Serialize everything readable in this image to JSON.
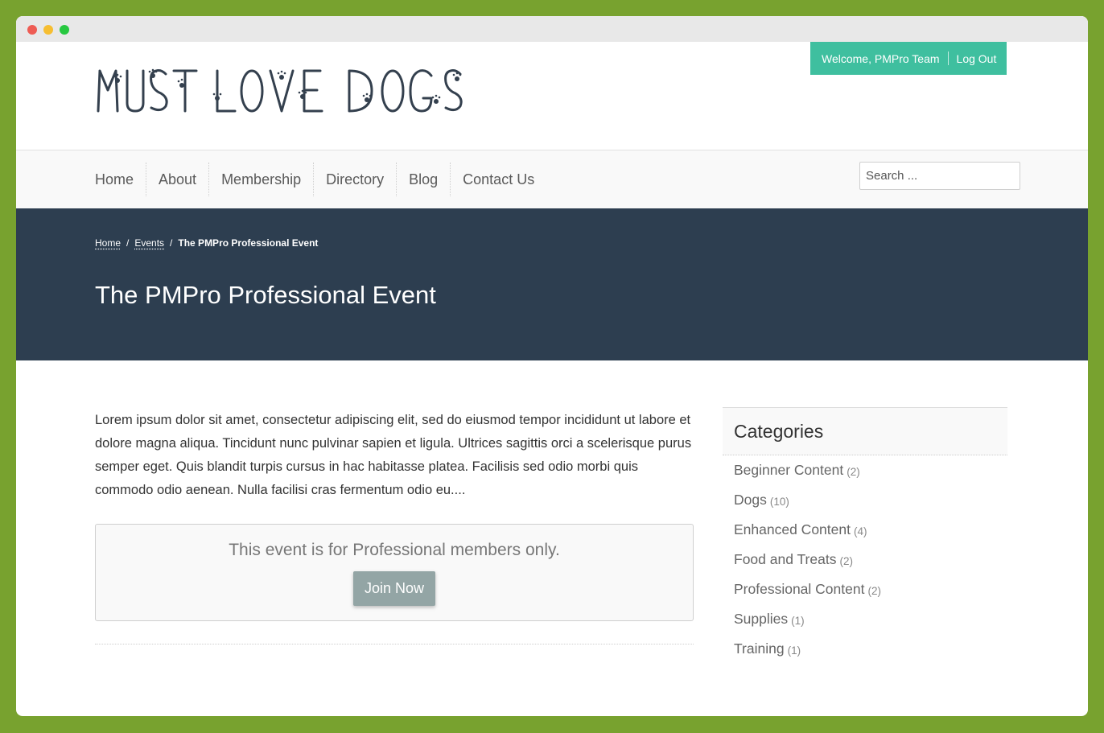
{
  "window_controls": {
    "close_color": "#ee5c54",
    "minimize_color": "#f6be31",
    "zoom_color": "#27c840"
  },
  "header": {
    "logo_text": "MUST LOVE DOGS",
    "welcome_text": "Welcome, PMPro Team",
    "logout_label": "Log Out",
    "accent_color": "#3fbf9f"
  },
  "nav": {
    "items": [
      {
        "label": "Home"
      },
      {
        "label": "About"
      },
      {
        "label": "Membership"
      },
      {
        "label": "Directory"
      },
      {
        "label": "Blog"
      },
      {
        "label": "Contact Us"
      }
    ],
    "search_placeholder": "Search ..."
  },
  "hero": {
    "breadcrumb": {
      "home": "Home",
      "events": "Events",
      "current": "The PMPro Professional Event"
    },
    "title": "The PMPro Professional Event",
    "background_color": "#2d3e50"
  },
  "main": {
    "body": "Lorem ipsum dolor sit amet, consectetur adipiscing elit, sed do eiusmod tempor incididunt ut labore et dolore magna aliqua. Tincidunt nunc pulvinar sapien et ligula. Ultrices sagittis orci a scelerisque purus semper eget. Quis blandit turpis cursus in hac habitasse platea. Facilisis sed odio morbi quis commodo odio aenean. Nulla facilisi cras fermentum odio eu....",
    "notice_text": "This event is for Professional members only.",
    "join_label": "Join Now"
  },
  "sidebar": {
    "title": "Categories",
    "categories": [
      {
        "name": "Beginner Content",
        "count": "(2)"
      },
      {
        "name": "Dogs",
        "count": "(10)"
      },
      {
        "name": "Enhanced Content",
        "count": "(4)"
      },
      {
        "name": "Food and Treats",
        "count": "(2)"
      },
      {
        "name": "Professional Content",
        "count": "(2)"
      },
      {
        "name": "Supplies",
        "count": "(1)"
      },
      {
        "name": "Training",
        "count": "(1)"
      }
    ]
  }
}
